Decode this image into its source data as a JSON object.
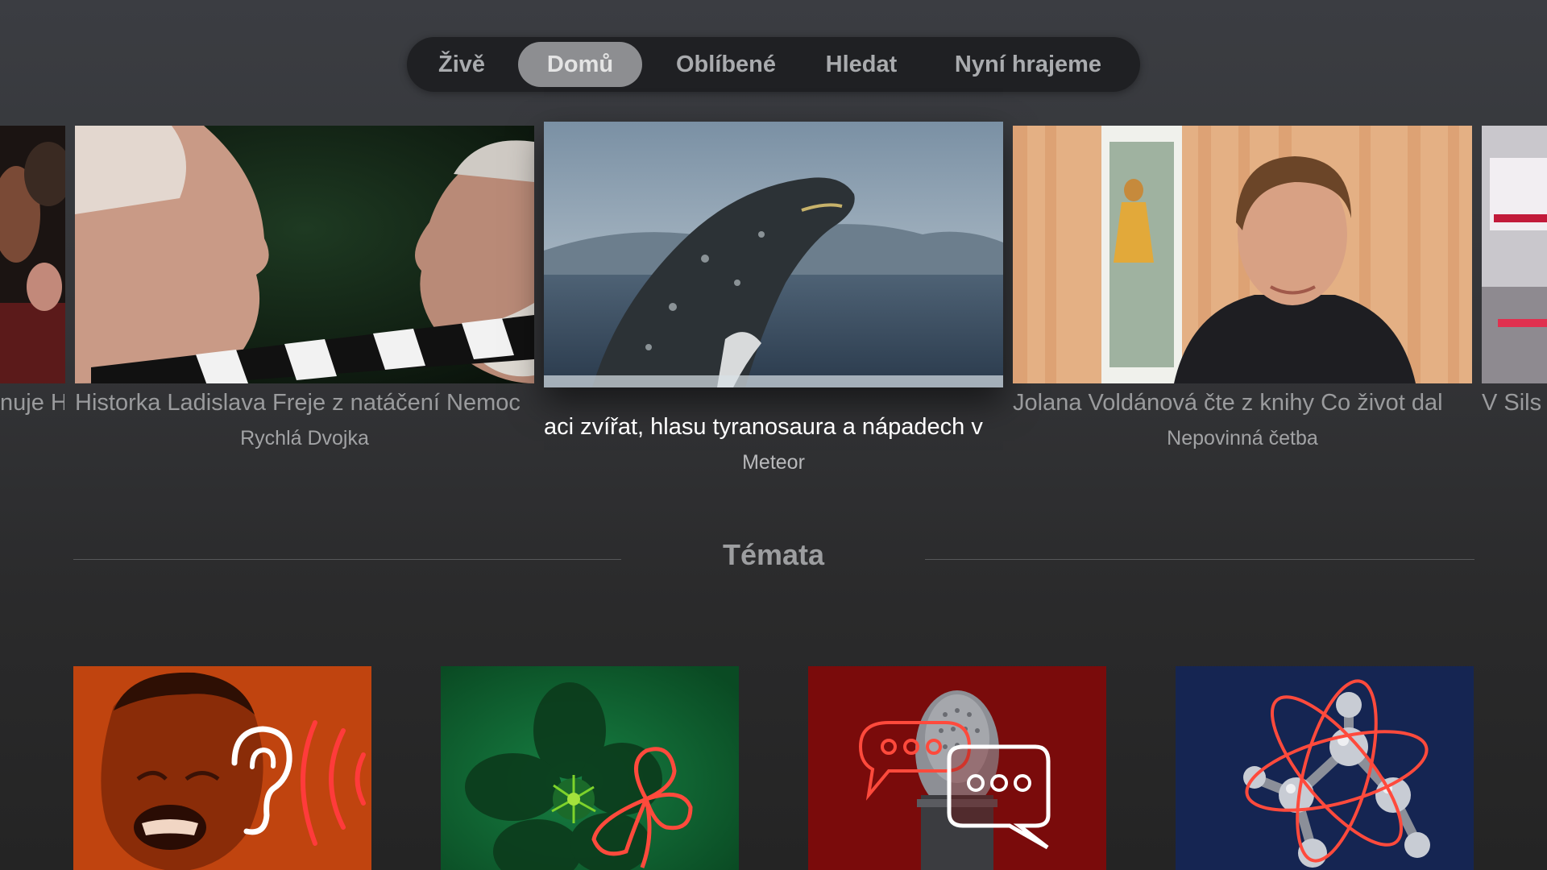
{
  "nav": {
    "items": [
      {
        "label": "Živě"
      },
      {
        "label": "Domů"
      },
      {
        "label": "Oblíbené"
      },
      {
        "label": "Hledat"
      },
      {
        "label": "Nyní hrajeme"
      }
    ],
    "active_index": 1
  },
  "carousel": {
    "items": [
      {
        "title": "nuje H",
        "subtitle": ""
      },
      {
        "title": "Historka Ladislava Freje z natáčení Nemoc",
        "subtitle": "Rychlá Dvojka"
      },
      {
        "title": "aci zvířat, hlasu tyranosaura a nápadech v",
        "subtitle": "Meteor"
      },
      {
        "title": "Jolana Voldánová čte z knihy Co život dal",
        "subtitle": "Nepovinná četba"
      },
      {
        "title": "V Sils",
        "subtitle": ""
      }
    ],
    "focused_index": 2
  },
  "topics": {
    "heading": "Témata",
    "tiles": [
      {
        "icon": "ear-icon",
        "color": "#c0440f"
      },
      {
        "icon": "flower-icon",
        "color": "#10632f"
      },
      {
        "icon": "chat-bubbles-icon",
        "color": "#7a0b0b"
      },
      {
        "icon": "atom-icon",
        "color": "#152552"
      }
    ]
  },
  "colors": {
    "accent_red": "#ff4a3c",
    "nav_active_bg": "#8d8e91"
  }
}
